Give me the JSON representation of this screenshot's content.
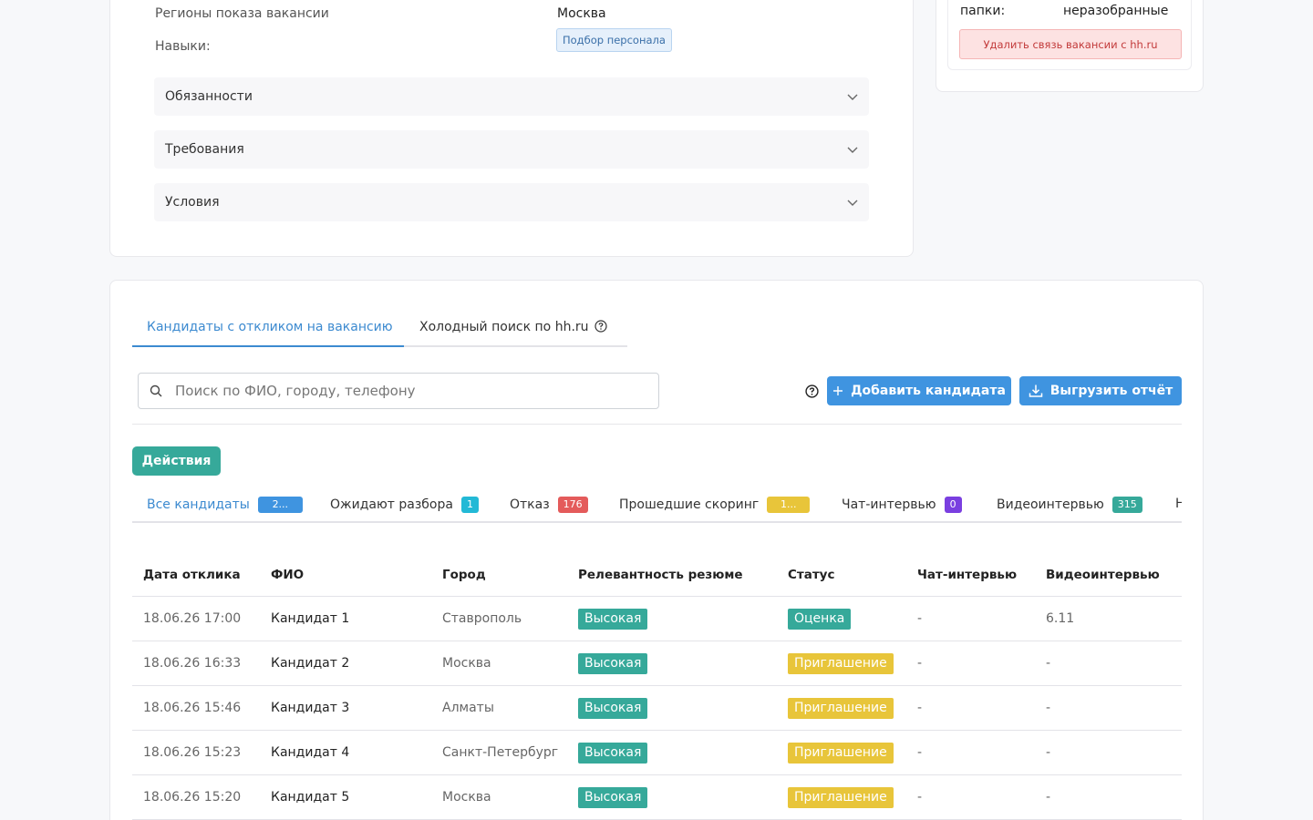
{
  "vacancy": {
    "regions_label": "Регионы показа вакансии",
    "regions_value": "Москва",
    "skills_label": "Навыки:",
    "skills": [
      "Подбор персонала"
    ],
    "sections": [
      "Обязанности",
      "Требования",
      "Условия"
    ]
  },
  "side": {
    "folder_label": "папки:",
    "folder_value": "неразобранные",
    "unlink_button": "Удалить связь вакансии с hh.ru"
  },
  "tabs": [
    {
      "label": "Кандидаты с откликом на вакансию",
      "active": true
    },
    {
      "label": "Холодный поиск по hh.ru",
      "active": false
    }
  ],
  "search": {
    "placeholder": "Поиск по ФИО, городу, телефону",
    "value": ""
  },
  "buttons": {
    "add_candidate": "Добавить кандидата",
    "export_report": "Выгрузить отчёт",
    "actions": "Действия"
  },
  "filters": [
    {
      "label": "Все кандидаты",
      "count": "2...",
      "color": "#3f94e0",
      "active": true
    },
    {
      "label": "Ожидают разбора",
      "count": "1",
      "color": "#23b9d6"
    },
    {
      "label": "Отказ",
      "count": "176",
      "color": "#e45b5b"
    },
    {
      "label": "Прошедшие скоринг",
      "count": "1...",
      "color": "#e8c53a"
    },
    {
      "label": "Чат-интервью",
      "count": "0",
      "color": "#7a3fe0"
    },
    {
      "label": "Видеоинтервью",
      "count": "315",
      "color": "#36a99a"
    },
    {
      "label": "Н",
      "count": "",
      "color": ""
    }
  ],
  "table": {
    "headers": [
      "Дата отклика",
      "ФИО",
      "Город",
      "Релевантность резюме",
      "Статус",
      "Чат-интервью",
      "Видеоинтервью"
    ],
    "rows": [
      {
        "date": "18.06.26 17:00",
        "name": "Кандидат 1",
        "city": "Ставрополь",
        "relevance": "Высокая",
        "status": "Оценка",
        "status_color": "#36a99a",
        "chat": "-",
        "video": "6.11"
      },
      {
        "date": "18.06.26 16:33",
        "name": "Кандидат 2",
        "city": "Москва",
        "relevance": "Высокая",
        "status": "Приглашение",
        "status_color": "#e8c53a",
        "chat": "-",
        "video": "-"
      },
      {
        "date": "18.06.26 15:46",
        "name": "Кандидат 3",
        "city": "Алматы",
        "relevance": "Высокая",
        "status": "Приглашение",
        "status_color": "#e8c53a",
        "chat": "-",
        "video": "-"
      },
      {
        "date": "18.06.26 15:23",
        "name": "Кандидат 4",
        "city": "Санкт-Петербург",
        "relevance": "Высокая",
        "status": "Приглашение",
        "status_color": "#e8c53a",
        "chat": "-",
        "video": "-"
      },
      {
        "date": "18.06.26 15:20",
        "name": "Кандидат 5",
        "city": "Москва",
        "relevance": "Высокая",
        "status": "Приглашение",
        "status_color": "#e8c53a",
        "chat": "-",
        "video": "-"
      }
    ]
  },
  "colors": {
    "accent": "#3f94e0",
    "green": "#36a99a",
    "relevance_high": "#36a99a"
  }
}
